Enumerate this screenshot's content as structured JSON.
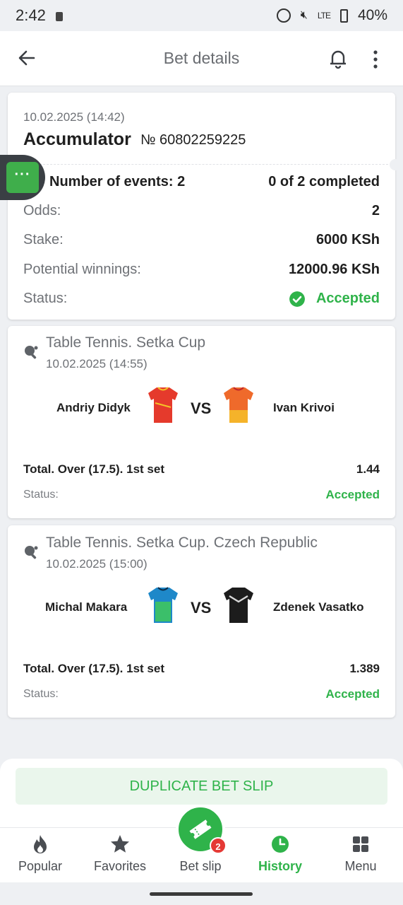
{
  "status_bar": {
    "time": "2:42",
    "signal": "LTE",
    "battery": "40%"
  },
  "header": {
    "title": "Bet details"
  },
  "bet": {
    "date": "10.02.2025 (14:42)",
    "type": "Accumulator",
    "number": "№ 60802259225",
    "events_label": "Number of events: 2",
    "completed": "0 of 2 completed",
    "odds_label": "Odds:",
    "odds_value": "2",
    "stake_label": "Stake:",
    "stake_value": "6000 KSh",
    "winnings_label": "Potential winnings:",
    "winnings_value": "12000.96 KSh",
    "status_label": "Status:",
    "status_value": "Accepted",
    "floating_tab": "···"
  },
  "events": [
    {
      "league": "Table Tennis. Setka Cup",
      "date": "10.02.2025 (14:55)",
      "team1": "Andriy Didyk",
      "team2": "Ivan Krivoi",
      "vs": "VS",
      "market": "Total. Over (17.5). 1st set",
      "odds": "1.44",
      "status_label": "Status:",
      "status": "Accepted"
    },
    {
      "league": "Table Tennis. Setka Cup. Czech Republic",
      "date": "10.02.2025 (15:00)",
      "team1": "Michal Makara",
      "team2": "Zdenek Vasatko",
      "vs": "VS",
      "market": "Total. Over (17.5). 1st set",
      "odds": "1.389",
      "status_label": "Status:",
      "status": "Accepted"
    }
  ],
  "duplicate_button": "DUPLICATE BET SLIP",
  "nav": {
    "items": [
      {
        "label": "Popular",
        "icon": "fire-icon"
      },
      {
        "label": "Favorites",
        "icon": "star-icon"
      },
      {
        "label": "Bet slip",
        "icon": "ticket-icon"
      },
      {
        "label": "History",
        "icon": "clock-icon"
      },
      {
        "label": "Menu",
        "icon": "grid-icon"
      }
    ],
    "active": "History",
    "betslip_badge": "2"
  },
  "colors": {
    "accent": "#2fb34a",
    "background": "#eef0f3",
    "badge": "#e53935"
  }
}
